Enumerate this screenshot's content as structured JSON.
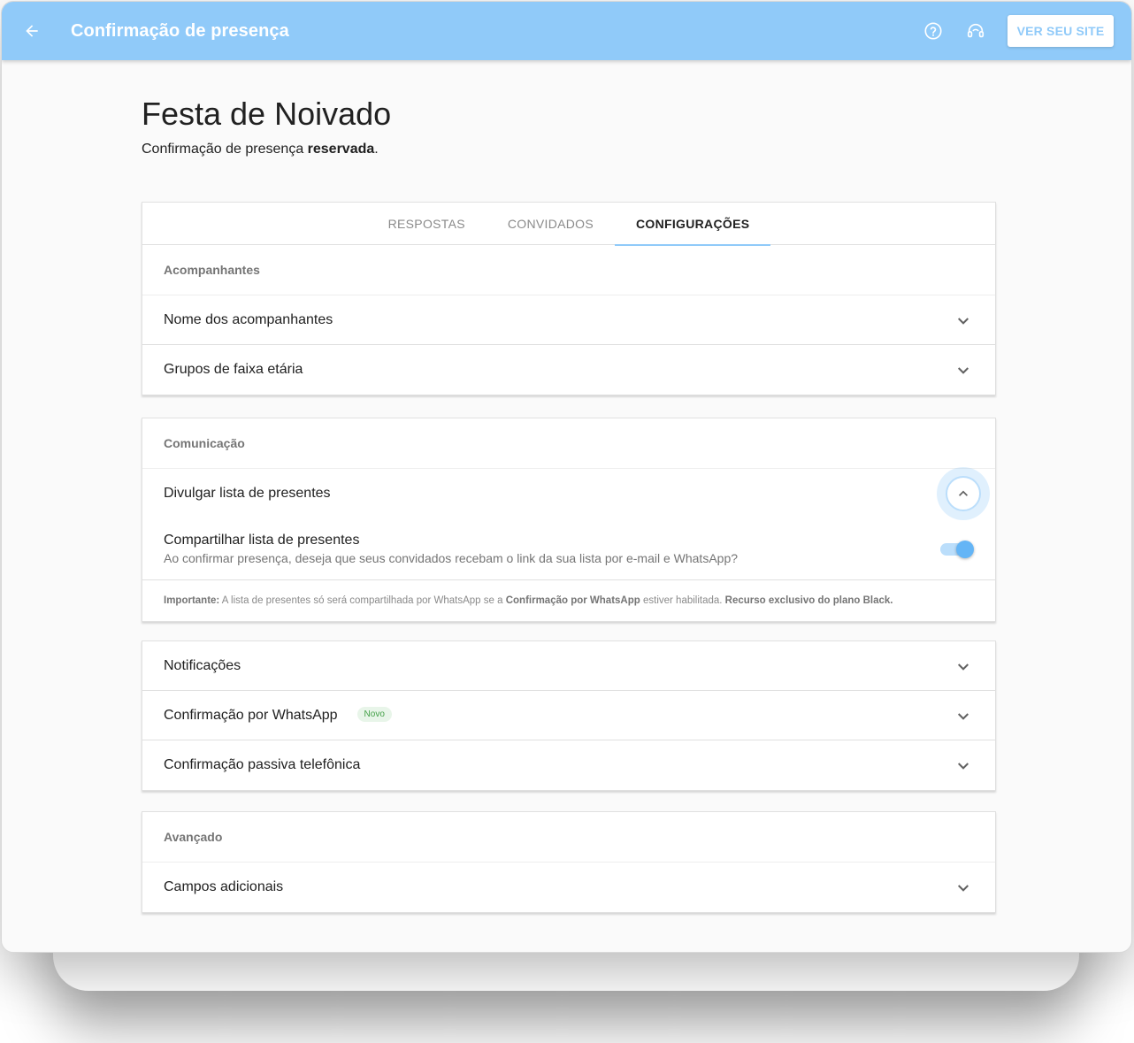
{
  "appbar": {
    "title": "Confirmação de presença",
    "back_icon": "arrow-left-icon",
    "help_icon": "help-circle-icon",
    "support_icon": "headset-icon",
    "site_button": "VER SEU SITE",
    "color": "#90caf9"
  },
  "page": {
    "title": "Festa de Noivado",
    "subtitle_prefix": "Confirmação de presença ",
    "subtitle_strong": "reservada",
    "subtitle_suffix": "."
  },
  "tabs": [
    {
      "label": "RESPOSTAS"
    },
    {
      "label": "CONVIDADOS"
    },
    {
      "label": "CONFIGURAÇÕES",
      "active": true
    }
  ],
  "acompanhantes": {
    "heading": "Acompanhantes",
    "items": [
      {
        "label": "Nome dos acompanhantes"
      },
      {
        "label": "Grupos de faixa etária"
      }
    ]
  },
  "comunicacao": {
    "heading": "Comunicação",
    "expanded_item": "Divulgar lista de presentes",
    "share_title": "Compartilhar lista de presentes",
    "share_desc": "Ao confirmar presença, deseja que seus convidados recebam o link da sua lista por e-mail e WhatsApp?",
    "share_enabled": true,
    "note_important": "Importante:",
    "note_text_1": " A lista de presentes só será compartilhada por WhatsApp se a ",
    "note_bold_1": "Confirmação por WhatsApp",
    "note_text_2": " estiver habilitada. ",
    "note_bold_2": "Recurso exclusivo do plano Black."
  },
  "notificacoes": {
    "items": [
      {
        "label": "Notificações"
      },
      {
        "label": "Confirmação por WhatsApp",
        "badge": "Novo"
      },
      {
        "label": "Confirmação passiva telefônica"
      }
    ]
  },
  "avancado": {
    "heading": "Avançado",
    "items": [
      {
        "label": "Campos adicionais"
      }
    ]
  }
}
